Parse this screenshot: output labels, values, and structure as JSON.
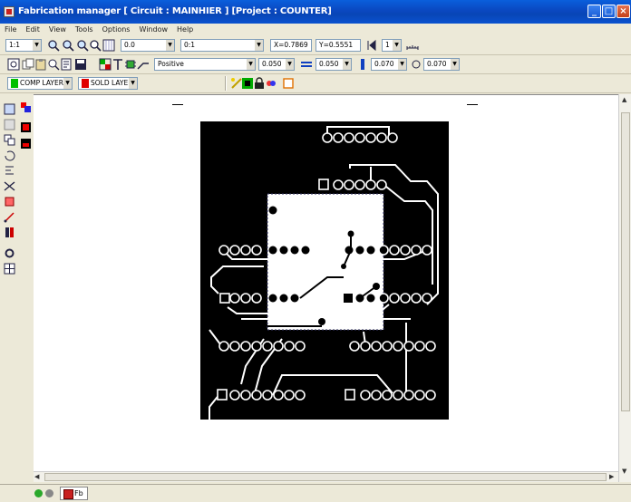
{
  "window": {
    "title": "Fabrication manager [ Circuit : MAINHIER ] [Project : COUNTER]",
    "minimize": "_",
    "maximize": "□",
    "close": "×"
  },
  "menu": [
    "File",
    "Edit",
    "View",
    "Tools",
    "Options",
    "Window",
    "Help"
  ],
  "toolbar1": {
    "zoom_value": "1:1",
    "grid_value": "0.0",
    "snap_value": "0:1",
    "x_coord": "X=0.7869",
    "y_coord": "Y=0.5551",
    "page_value": "1"
  },
  "toolbar2": {
    "layer_select": "Positive",
    "line_width": "0.050",
    "pad_size": "0.050",
    "via_size": "0.070",
    "drill_size": "0.070"
  },
  "toolbar3": {
    "top_layer": "COMP LAYER",
    "top_layer_color": "#00c000",
    "bottom_layer": "SOLD LAYER",
    "bottom_layer_color": "#e00000"
  },
  "statusbar": {
    "tab_label": "Fb"
  },
  "icons": {
    "app": "app-icon",
    "pcb": "pcb-layout-icon"
  }
}
